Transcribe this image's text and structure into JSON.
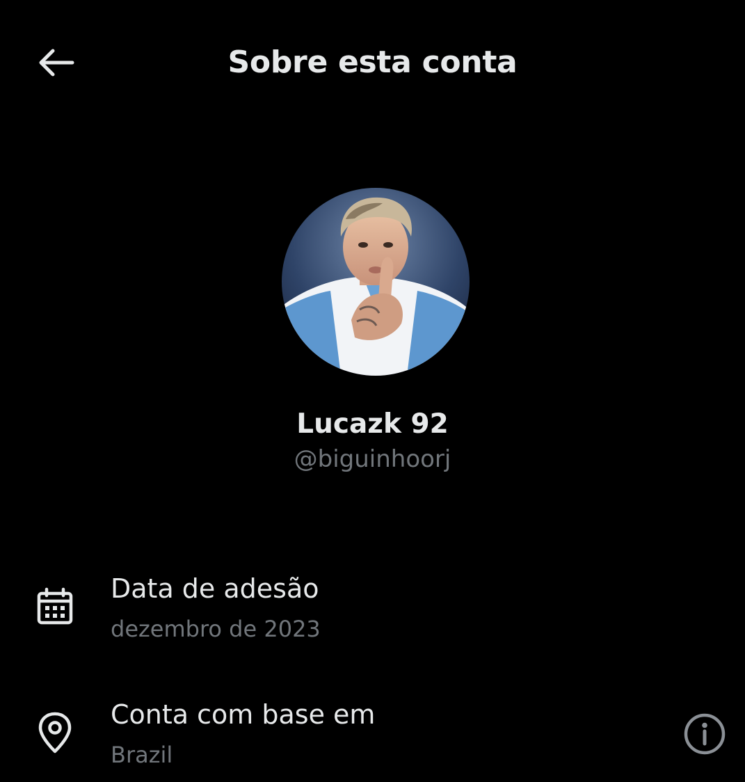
{
  "header": {
    "back_icon": "arrow-left-icon",
    "title": "Sobre esta conta"
  },
  "profile": {
    "avatar": "profile-photo",
    "display_name": "Lucazk 92",
    "handle": "@biguinhoorj"
  },
  "info": [
    {
      "icon": "calendar-icon",
      "label": "Data de adesão",
      "value": "dezembro de 2023"
    },
    {
      "icon": "location-pin-icon",
      "label": "Conta com base em",
      "value": "Brazil",
      "action_icon": "info-circle-icon"
    }
  ],
  "colors": {
    "background": "#000000",
    "primary_text": "#e7e9ea",
    "secondary_text": "#71767b"
  }
}
